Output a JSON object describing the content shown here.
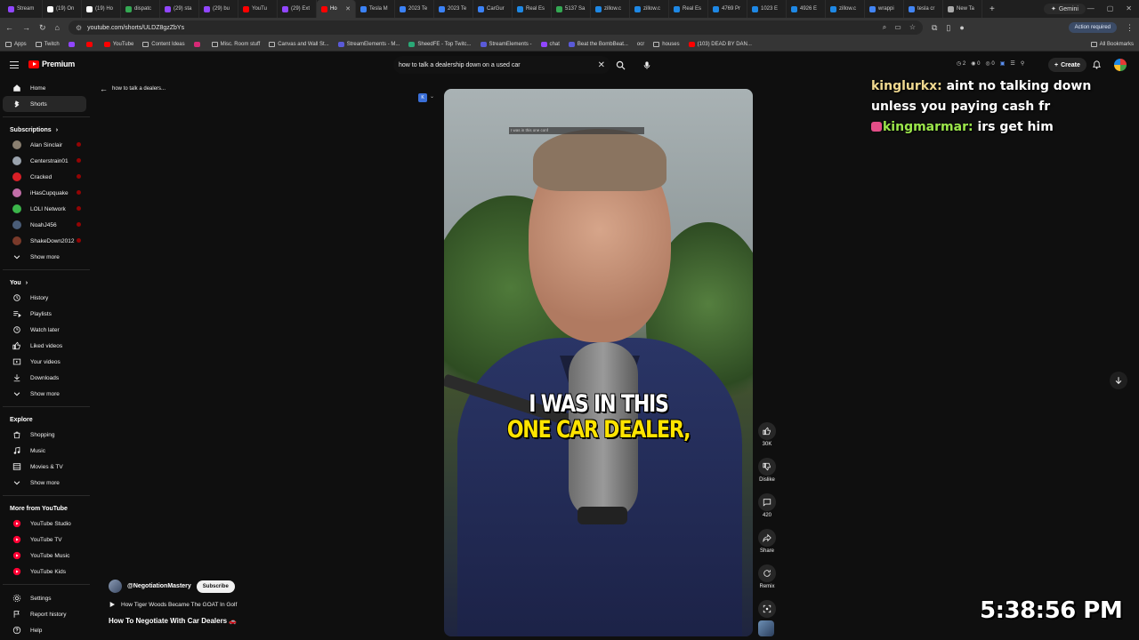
{
  "browser": {
    "tabs": [
      {
        "label": "Stream",
        "color": "#9146ff"
      },
      {
        "label": "(19) On",
        "color": "#ffffff"
      },
      {
        "label": "(19) Ho",
        "color": "#ffffff"
      },
      {
        "label": "dispatc",
        "color": "#34a853"
      },
      {
        "label": "(29) sta",
        "color": "#9146ff"
      },
      {
        "label": "(29) bu",
        "color": "#9146ff"
      },
      {
        "label": "YouTu",
        "color": "#ff0000"
      },
      {
        "label": "(29) Ext",
        "color": "#9146ff"
      },
      {
        "label": "Ho",
        "color": "#ff0000",
        "active": true
      },
      {
        "label": "Tesla M",
        "color": "#3b82f6"
      },
      {
        "label": "2023 Te",
        "color": "#3b82f6"
      },
      {
        "label": "2023 Te",
        "color": "#3b82f6"
      },
      {
        "label": "CarGur",
        "color": "#3b82f6"
      },
      {
        "label": "Real Es",
        "color": "#1e88e5"
      },
      {
        "label": "5137 Sa",
        "color": "#34a853"
      },
      {
        "label": "zillow.c",
        "color": "#1e88e5"
      },
      {
        "label": "zillow.c",
        "color": "#1e88e5"
      },
      {
        "label": "Real Es",
        "color": "#1e88e5"
      },
      {
        "label": "4769 Pr",
        "color": "#1e88e5"
      },
      {
        "label": "1023 E",
        "color": "#1e88e5"
      },
      {
        "label": "4926 E",
        "color": "#1e88e5"
      },
      {
        "label": "zillow.c",
        "color": "#1e88e5"
      },
      {
        "label": "wrappi",
        "color": "#4285f4"
      },
      {
        "label": "tesla cr",
        "color": "#4285f4"
      },
      {
        "label": "New Ta",
        "color": "#aaaaaa"
      }
    ],
    "gemini_label": "Gemini",
    "url": "youtube.com/shorts/ULDZ8gzZbYs",
    "action_required": "Action required",
    "bookmarks": [
      {
        "label": "Apps",
        "type": "grid"
      },
      {
        "label": "Twitch",
        "type": "folder"
      },
      {
        "label": "",
        "type": "twitch"
      },
      {
        "label": "",
        "type": "yt"
      },
      {
        "label": "YouTube",
        "type": "yt"
      },
      {
        "label": "Content Ideas",
        "type": "folder"
      },
      {
        "label": "",
        "type": "ig"
      },
      {
        "label": "Misc. Room stuff",
        "type": "folder"
      },
      {
        "label": "Canvas and Wall St...",
        "type": "folder"
      },
      {
        "label": "StreamElements - M...",
        "type": "se"
      },
      {
        "label": "SheedFE - Top Twitc...",
        "type": "tt"
      },
      {
        "label": "StreamElements -",
        "type": "se"
      },
      {
        "label": "chat",
        "type": "twitch"
      },
      {
        "label": "Beat the BombBeat...",
        "type": "se"
      },
      {
        "label": "ocr",
        "type": "none"
      },
      {
        "label": "houses",
        "type": "folder"
      },
      {
        "label": "(103) DEAD BY DAN...",
        "type": "yt"
      }
    ],
    "all_bookmarks": "All Bookmarks"
  },
  "youtube": {
    "logo_text": "Premium",
    "search_value": "how to talk a dealership down on a used car",
    "create_label": "Create",
    "ext_counts": [
      "2",
      "0",
      "0"
    ],
    "back_label": "how to talk a dealers...",
    "sidebar": {
      "main": [
        {
          "label": "Home",
          "icon": "home-icon"
        },
        {
          "label": "Shorts",
          "icon": "shorts-icon",
          "active": true
        }
      ],
      "subscriptions_title": "Subscriptions",
      "subscriptions": [
        {
          "label": "Alan Sinclair",
          "color": "#8a7f70"
        },
        {
          "label": "Centerstrain01",
          "color": "#9aa3ad"
        },
        {
          "label": "Cracked",
          "color": "#d91f26"
        },
        {
          "label": "iHasCupquake",
          "color": "#c26ea8"
        },
        {
          "label": "LOLI Network",
          "color": "#3bb54a"
        },
        {
          "label": "NoahJ456",
          "color": "#4a5d78"
        },
        {
          "label": "ShakeDown2012",
          "color": "#7a3a2a"
        }
      ],
      "show_more": "Show more",
      "you_title": "You",
      "you_items": [
        {
          "label": "History",
          "icon": "history-icon"
        },
        {
          "label": "Playlists",
          "icon": "playlists-icon"
        },
        {
          "label": "Watch later",
          "icon": "clock-icon"
        },
        {
          "label": "Liked videos",
          "icon": "thumb-up-icon"
        },
        {
          "label": "Your videos",
          "icon": "your-videos-icon"
        },
        {
          "label": "Downloads",
          "icon": "download-icon"
        },
        {
          "label": "Show more",
          "icon": "chevron-down-icon"
        }
      ],
      "explore_title": "Explore",
      "explore_items": [
        {
          "label": "Shopping",
          "icon": "bag-icon"
        },
        {
          "label": "Music",
          "icon": "music-icon"
        },
        {
          "label": "Movies & TV",
          "icon": "film-icon"
        },
        {
          "label": "Show more",
          "icon": "chevron-down-icon"
        }
      ],
      "more_title": "More from YouTube",
      "more_items": [
        {
          "label": "YouTube Studio"
        },
        {
          "label": "YouTube TV"
        },
        {
          "label": "YouTube Music"
        },
        {
          "label": "YouTube Kids"
        }
      ],
      "bottom_items": [
        {
          "label": "Settings",
          "icon": "gear-icon"
        },
        {
          "label": "Report history",
          "icon": "flag-icon"
        },
        {
          "label": "Help",
          "icon": "help-icon"
        }
      ]
    },
    "short": {
      "top_caption": "I was in this one conf",
      "caption_line1": "I WAS IN THIS",
      "caption_line2": "ONE CAR DEALER,",
      "likes": "30K",
      "dislike": "Dislike",
      "comments": "420",
      "share": "Share",
      "remix": "Remix",
      "channel": "@NegotiationMastery",
      "subscribe": "Subscribe",
      "related": "How Tiger Woods Became The GOAT In Golf",
      "title": "How To Negotiate With Car Dealers"
    }
  },
  "overlay": {
    "chat": [
      {
        "user": "kinglurkx",
        "msg": " aint no talking down"
      },
      {
        "user": "",
        "msg": "unless you paying cash fr"
      },
      {
        "user": "kingmarmar",
        "msg": " irs get him"
      }
    ],
    "clock": "5:38:56 PM"
  }
}
